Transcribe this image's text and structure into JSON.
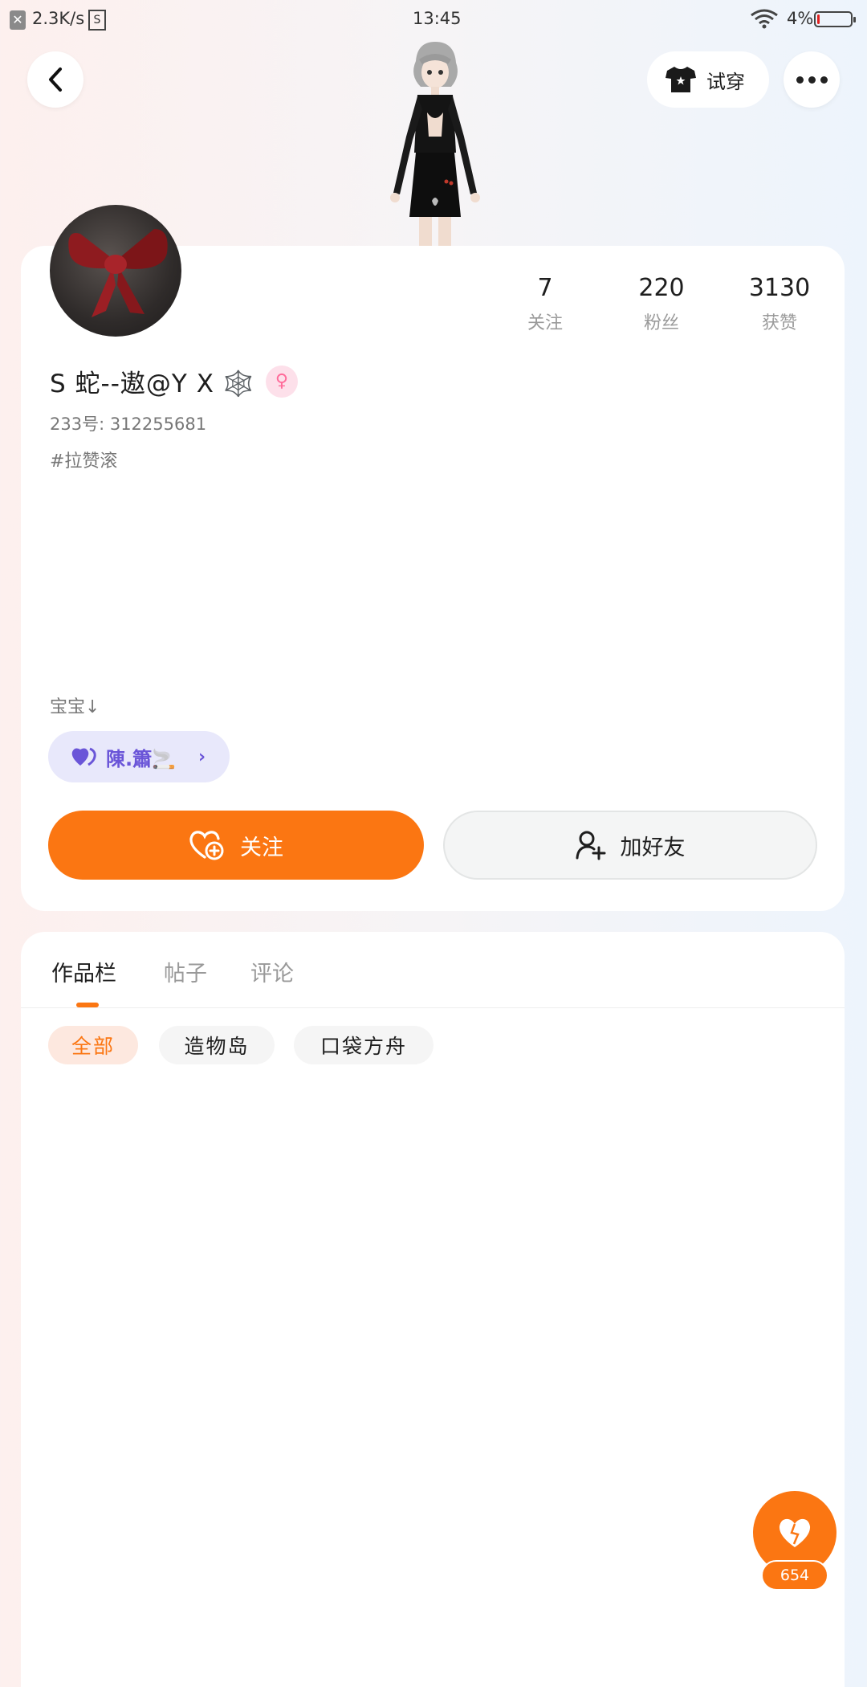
{
  "status_bar": {
    "net_speed": "2.3K/s",
    "s_icon": "S",
    "time": "13:45",
    "battery": "4%"
  },
  "header": {
    "tryon_label": "试穿"
  },
  "profile": {
    "stats": [
      {
        "value": "7",
        "label": "关注"
      },
      {
        "value": "220",
        "label": "粉丝"
      },
      {
        "value": "3130",
        "label": "获赞"
      }
    ],
    "nickname": "S 蛇--遨@Y X 🕸️",
    "uid": "233号: 312255681",
    "tag": "#拉赞滚",
    "bio": "宝宝↓",
    "fan_chip": "陳.簫🚬"
  },
  "actions": {
    "follow": "关注",
    "add_friend": "加好友"
  },
  "tabs": [
    "作品栏",
    "帖子",
    "评论"
  ],
  "filters": [
    "全部",
    "造物岛",
    "口袋方舟"
  ],
  "like_count": "654",
  "colors": {
    "accent": "#fb7612",
    "fan_chip_bg": "#e8e8fb",
    "fan_chip_text": "#6a55d8"
  }
}
